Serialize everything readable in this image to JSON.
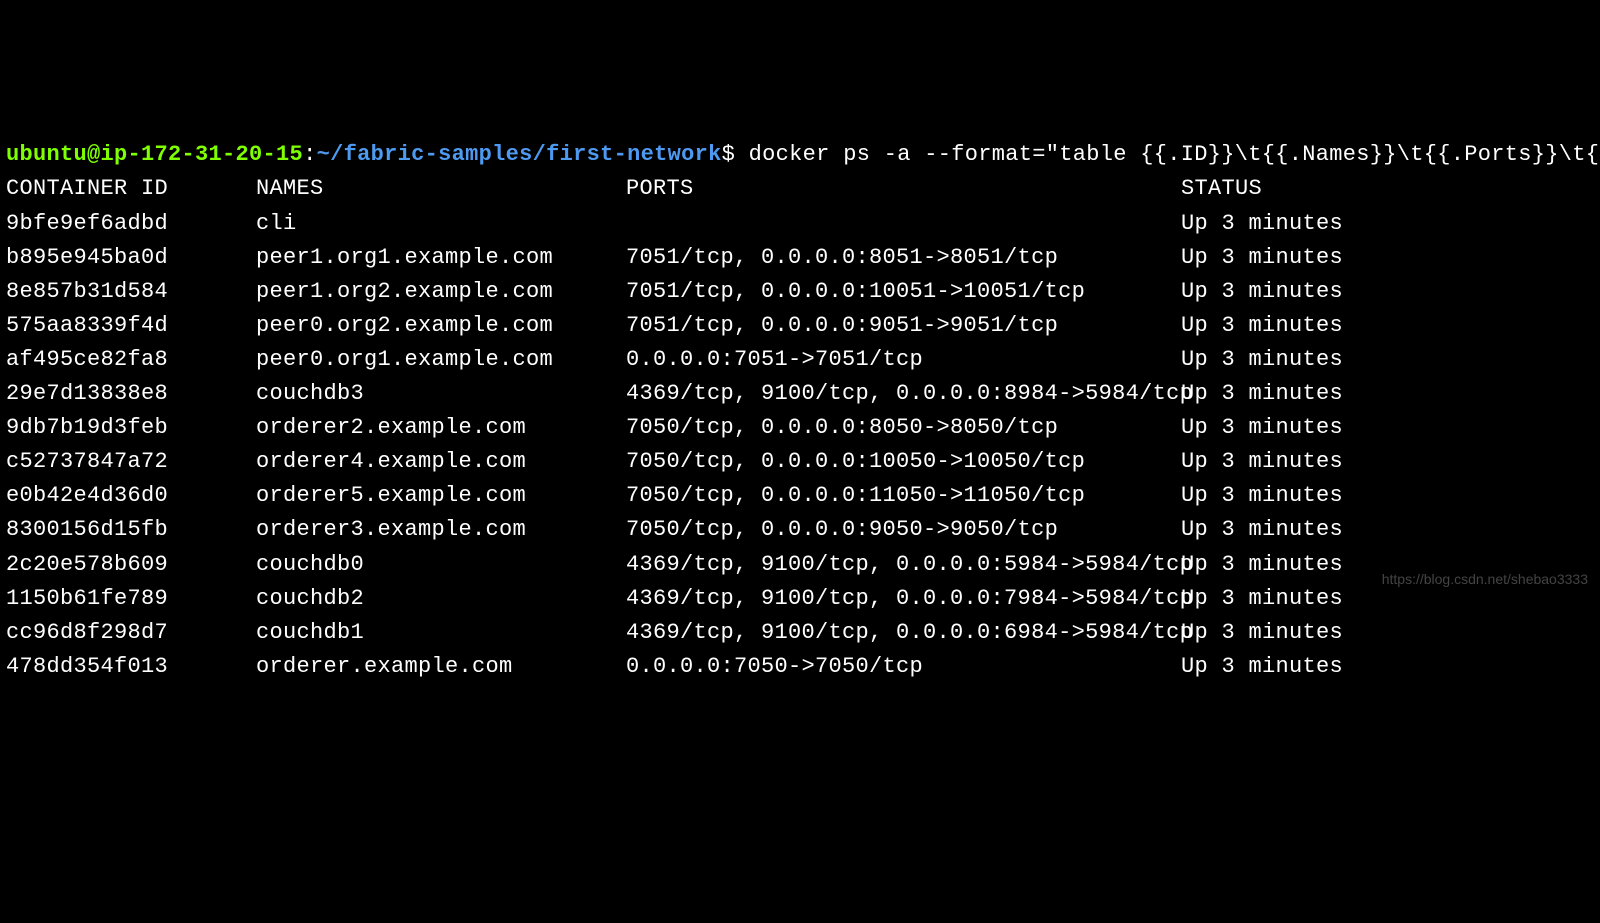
{
  "prompt": {
    "user_host": "ubuntu@ip-172-31-20-15",
    "colon": ":",
    "path": "~/fabric-samples/first-network",
    "dollar": "$",
    "command": " docker ps -a --format=\"table {{.ID}}\\t{{.Names}}\\t{{.Ports}}\\t{{.Status}}\""
  },
  "headers": {
    "id": "CONTAINER ID",
    "names": "NAMES",
    "ports": "PORTS",
    "status": "STATUS"
  },
  "rows": [
    {
      "id": "9bfe9ef6adbd",
      "names": "cli",
      "ports": "",
      "status": "Up 3 minutes"
    },
    {
      "id": "b895e945ba0d",
      "names": "peer1.org1.example.com",
      "ports": "7051/tcp, 0.0.0.0:8051->8051/tcp",
      "status": "Up 3 minutes"
    },
    {
      "id": "8e857b31d584",
      "names": "peer1.org2.example.com",
      "ports": "7051/tcp, 0.0.0.0:10051->10051/tcp",
      "status": "Up 3 minutes"
    },
    {
      "id": "575aa8339f4d",
      "names": "peer0.org2.example.com",
      "ports": "7051/tcp, 0.0.0.0:9051->9051/tcp",
      "status": "Up 3 minutes"
    },
    {
      "id": "af495ce82fa8",
      "names": "peer0.org1.example.com",
      "ports": "0.0.0.0:7051->7051/tcp",
      "status": "Up 3 minutes"
    },
    {
      "id": "29e7d13838e8",
      "names": "couchdb3",
      "ports": "4369/tcp, 9100/tcp, 0.0.0.0:8984->5984/tcp",
      "status": "Up 3 minutes"
    },
    {
      "id": "9db7b19d3feb",
      "names": "orderer2.example.com",
      "ports": "7050/tcp, 0.0.0.0:8050->8050/tcp",
      "status": "Up 3 minutes"
    },
    {
      "id": "c52737847a72",
      "names": "orderer4.example.com",
      "ports": "7050/tcp, 0.0.0.0:10050->10050/tcp",
      "status": "Up 3 minutes"
    },
    {
      "id": "e0b42e4d36d0",
      "names": "orderer5.example.com",
      "ports": "7050/tcp, 0.0.0.0:11050->11050/tcp",
      "status": "Up 3 minutes"
    },
    {
      "id": "8300156d15fb",
      "names": "orderer3.example.com",
      "ports": "7050/tcp, 0.0.0.0:9050->9050/tcp",
      "status": "Up 3 minutes"
    },
    {
      "id": "2c20e578b609",
      "names": "couchdb0",
      "ports": "4369/tcp, 9100/tcp, 0.0.0.0:5984->5984/tcp",
      "status": "Up 3 minutes"
    },
    {
      "id": "1150b61fe789",
      "names": "couchdb2",
      "ports": "4369/tcp, 9100/tcp, 0.0.0.0:7984->5984/tcp",
      "status": "Up 3 minutes"
    },
    {
      "id": "cc96d8f298d7",
      "names": "couchdb1",
      "ports": "4369/tcp, 9100/tcp, 0.0.0.0:6984->5984/tcp",
      "status": "Up 3 minutes"
    },
    {
      "id": "478dd354f013",
      "names": "orderer.example.com",
      "ports": "0.0.0.0:7050->7050/tcp",
      "status": "Up 3 minutes"
    }
  ],
  "watermark": "https://blog.csdn.net/shebao3333"
}
